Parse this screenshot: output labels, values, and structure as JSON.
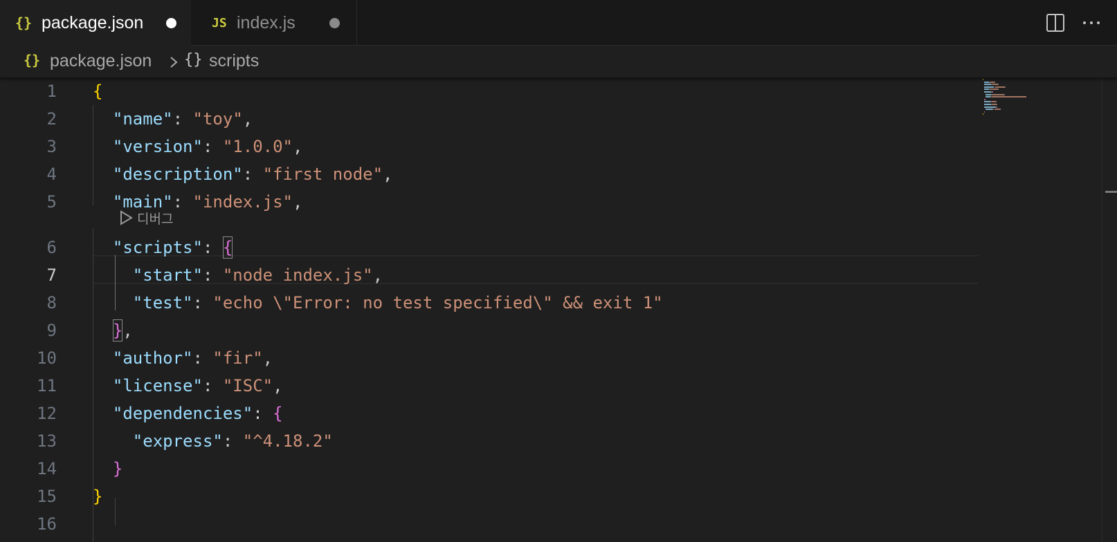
{
  "tabs": [
    {
      "icon": "{}",
      "label": "package.json",
      "active": true,
      "dirty": true
    },
    {
      "icon": "JS",
      "label": "index.js",
      "active": false,
      "dirty": true
    }
  ],
  "breadcrumb": {
    "icon": "{}",
    "file": "package.json",
    "symbol_icon": "{}",
    "symbol": "scripts"
  },
  "codelens": {
    "label": "디버그"
  },
  "current_line": 7,
  "lines": [
    {
      "n": "1",
      "tokens": [
        {
          "t": "{",
          "c": "b1"
        }
      ]
    },
    {
      "n": "2",
      "tokens": [
        {
          "t": "  "
        },
        {
          "t": "\"name\"",
          "c": "k"
        },
        {
          "t": ": ",
          "c": "p"
        },
        {
          "t": "\"toy\"",
          "c": "s"
        },
        {
          "t": ",",
          "c": "p"
        }
      ]
    },
    {
      "n": "3",
      "tokens": [
        {
          "t": "  "
        },
        {
          "t": "\"version\"",
          "c": "k"
        },
        {
          "t": ": ",
          "c": "p"
        },
        {
          "t": "\"1.0.0\"",
          "c": "s"
        },
        {
          "t": ",",
          "c": "p"
        }
      ]
    },
    {
      "n": "4",
      "tokens": [
        {
          "t": "  "
        },
        {
          "t": "\"description\"",
          "c": "k"
        },
        {
          "t": ": ",
          "c": "p"
        },
        {
          "t": "\"first node\"",
          "c": "s"
        },
        {
          "t": ",",
          "c": "p"
        }
      ]
    },
    {
      "n": "5",
      "tokens": [
        {
          "t": "  "
        },
        {
          "t": "\"main\"",
          "c": "k"
        },
        {
          "t": ": ",
          "c": "p"
        },
        {
          "t": "\"index.js\"",
          "c": "s"
        },
        {
          "t": ",",
          "c": "p"
        }
      ]
    },
    {
      "n": "6",
      "tokens": [
        {
          "t": "  "
        },
        {
          "t": "\"scripts\"",
          "c": "k"
        },
        {
          "t": ": ",
          "c": "p"
        },
        {
          "t": "{",
          "c": "b2 bmatch"
        }
      ]
    },
    {
      "n": "7",
      "tokens": [
        {
          "t": "    "
        },
        {
          "t": "\"start\"",
          "c": "k"
        },
        {
          "t": ": ",
          "c": "p"
        },
        {
          "t": "\"node index.js\"",
          "c": "s"
        },
        {
          "t": ",",
          "c": "p"
        }
      ]
    },
    {
      "n": "8",
      "tokens": [
        {
          "t": "    "
        },
        {
          "t": "\"test\"",
          "c": "k"
        },
        {
          "t": ": ",
          "c": "p"
        },
        {
          "t": "\"echo \\\"Error: no test specified\\\" && exit 1\"",
          "c": "s"
        }
      ]
    },
    {
      "n": "9",
      "tokens": [
        {
          "t": "  "
        },
        {
          "t": "}",
          "c": "b2 bmatch"
        },
        {
          "t": ",",
          "c": "p"
        }
      ]
    },
    {
      "n": "10",
      "tokens": [
        {
          "t": "  "
        },
        {
          "t": "\"author\"",
          "c": "k"
        },
        {
          "t": ": ",
          "c": "p"
        },
        {
          "t": "\"fir\"",
          "c": "s"
        },
        {
          "t": ",",
          "c": "p"
        }
      ]
    },
    {
      "n": "11",
      "tokens": [
        {
          "t": "  "
        },
        {
          "t": "\"license\"",
          "c": "k"
        },
        {
          "t": ": ",
          "c": "p"
        },
        {
          "t": "\"ISC\"",
          "c": "s"
        },
        {
          "t": ",",
          "c": "p"
        }
      ]
    },
    {
      "n": "12",
      "tokens": [
        {
          "t": "  "
        },
        {
          "t": "\"dependencies\"",
          "c": "k"
        },
        {
          "t": ": ",
          "c": "p"
        },
        {
          "t": "{",
          "c": "b2"
        }
      ]
    },
    {
      "n": "13",
      "tokens": [
        {
          "t": "    "
        },
        {
          "t": "\"express\"",
          "c": "k"
        },
        {
          "t": ": ",
          "c": "p"
        },
        {
          "t": "\"^4.18.2\"",
          "c": "s"
        }
      ]
    },
    {
      "n": "14",
      "tokens": [
        {
          "t": "  "
        },
        {
          "t": "}",
          "c": "b2"
        }
      ]
    },
    {
      "n": "15",
      "tokens": [
        {
          "t": "}",
          "c": "b1"
        }
      ]
    },
    {
      "n": "16",
      "tokens": []
    }
  ],
  "icons": {
    "split_editor": "split-editor-icon",
    "more": "more-actions-icon",
    "chevron": "chevron-right-icon",
    "play": "play-icon"
  },
  "colors": {
    "key": "#9cdcfe",
    "string": "#ce9178",
    "bracket_level1": "#ffd700",
    "bracket_level2": "#da70d6",
    "json_icon": "#cbcb41"
  }
}
